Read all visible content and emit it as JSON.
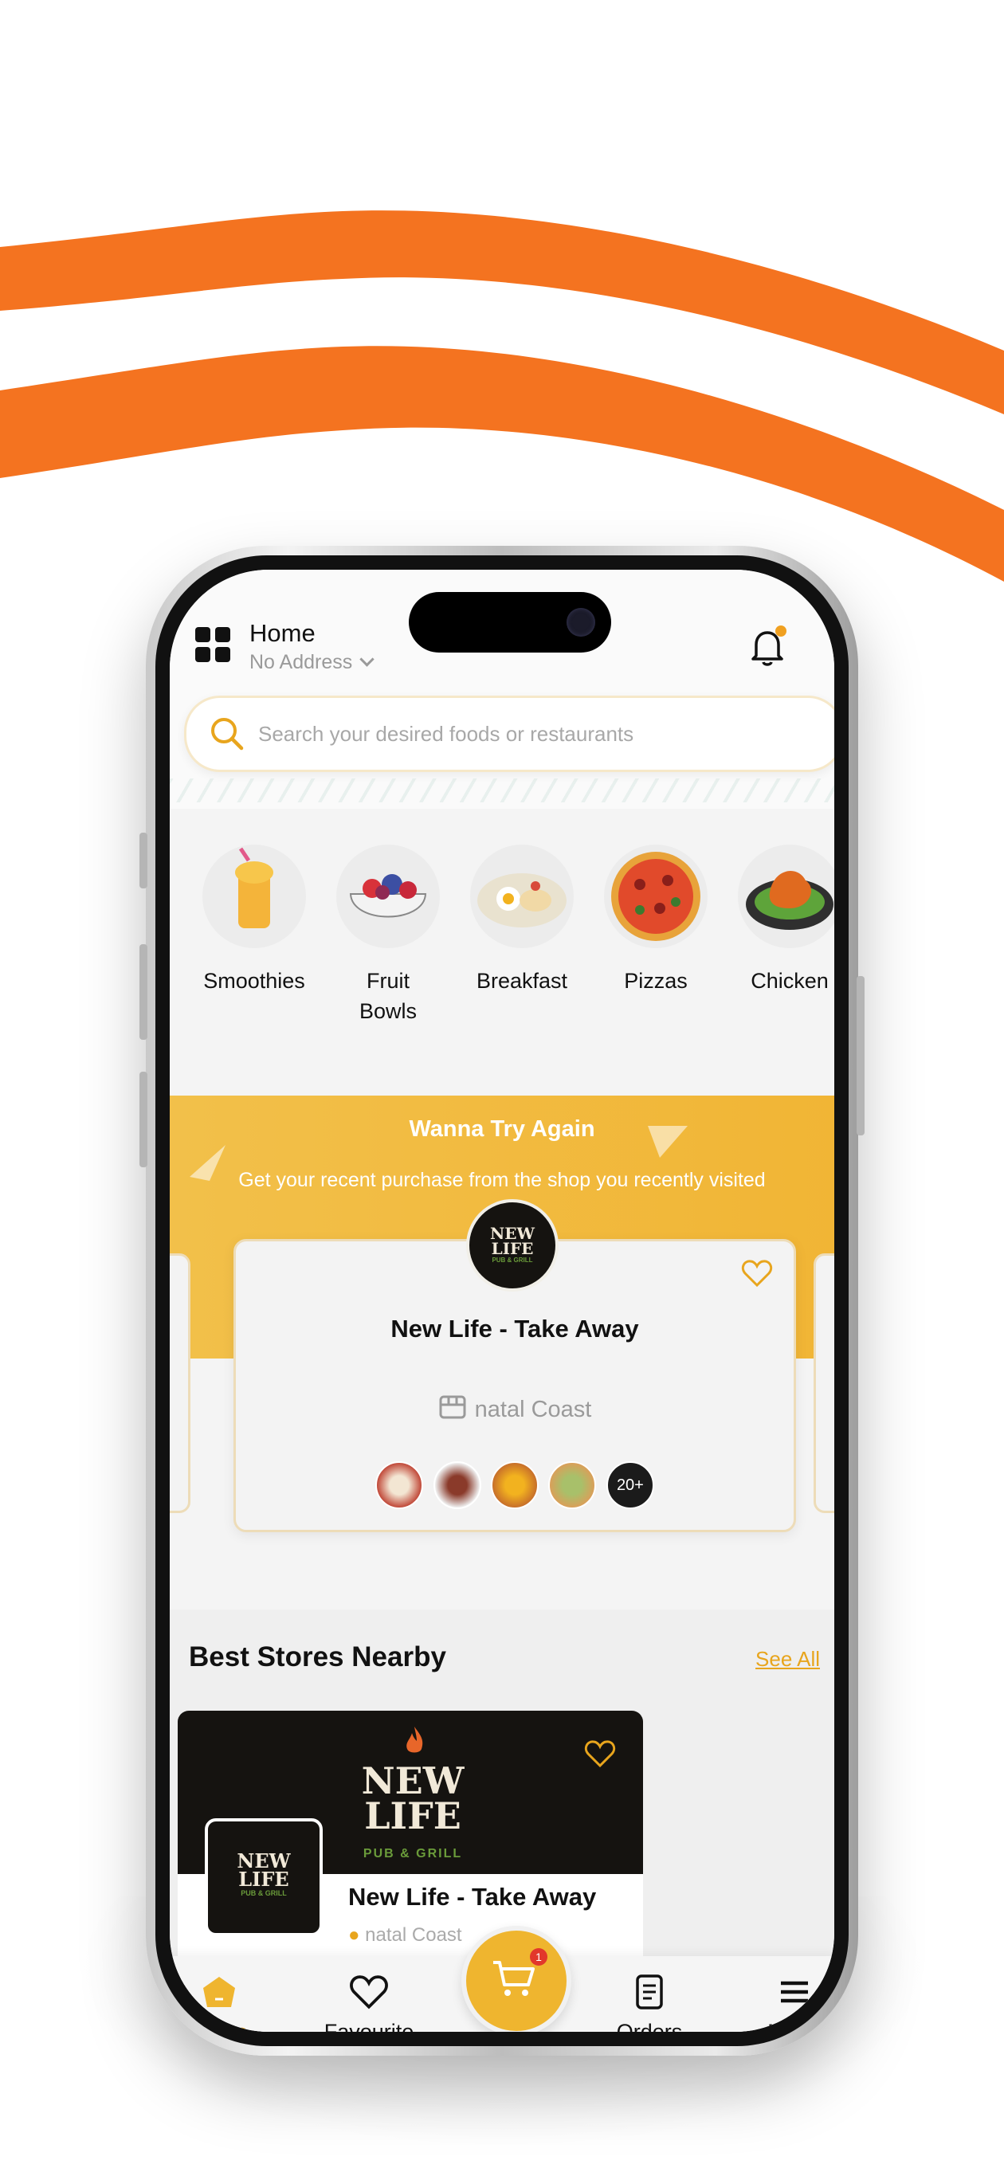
{
  "header": {
    "title": "Home",
    "address": "No Address"
  },
  "search": {
    "placeholder": "Search your desired foods or restaurants"
  },
  "categories": [
    {
      "label": "Smoothies"
    },
    {
      "label": "Fruit Bowls"
    },
    {
      "label": "Breakfast"
    },
    {
      "label": "Pizzas"
    },
    {
      "label": "Chicken"
    }
  ],
  "recent": {
    "title": "Wanna Try Again",
    "subtitle": "Get your recent purchase from the shop you recently visited",
    "store_name": "New Life - Take Away",
    "location": "natal Coast",
    "more_count": "20+",
    "logo_line1": "NEW",
    "logo_line2": "LIFE",
    "logo_sub": "PUB & GRILL"
  },
  "nearby": {
    "title": "Best Stores Nearby",
    "see_all": "See All",
    "store_name": "New Life - Take Away",
    "location": "natal Coast",
    "logo_line1": "NEW",
    "logo_line2": "LIFE",
    "logo_sub": "PUB & GRILL"
  },
  "nav": {
    "home": "Home",
    "favourite": "Favourite",
    "orders": "Orders",
    "menu": "Menu",
    "cart_badge": "1"
  },
  "colors": {
    "accent": "#f1b535",
    "brand_orange": "#f47320"
  }
}
